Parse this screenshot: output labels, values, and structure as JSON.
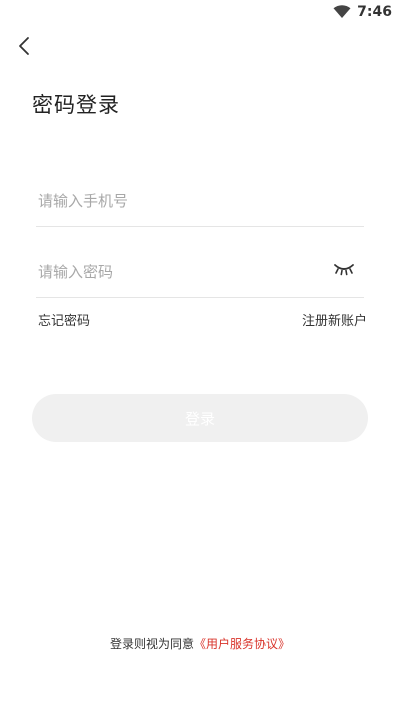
{
  "status_bar": {
    "time": "7:46"
  },
  "header": {
    "title": "密码登录"
  },
  "form": {
    "phone_placeholder": "请输入手机号",
    "password_placeholder": "请输入密码",
    "forgot_label": "忘记密码",
    "register_label": "注册新账户",
    "login_label": "登录"
  },
  "footer": {
    "agreement_prefix": "登录则视为同意",
    "agreement_link": "《用户服务协议》"
  },
  "colors": {
    "accent_link": "#d9342b",
    "button_disabled": "#f0f0f0"
  }
}
